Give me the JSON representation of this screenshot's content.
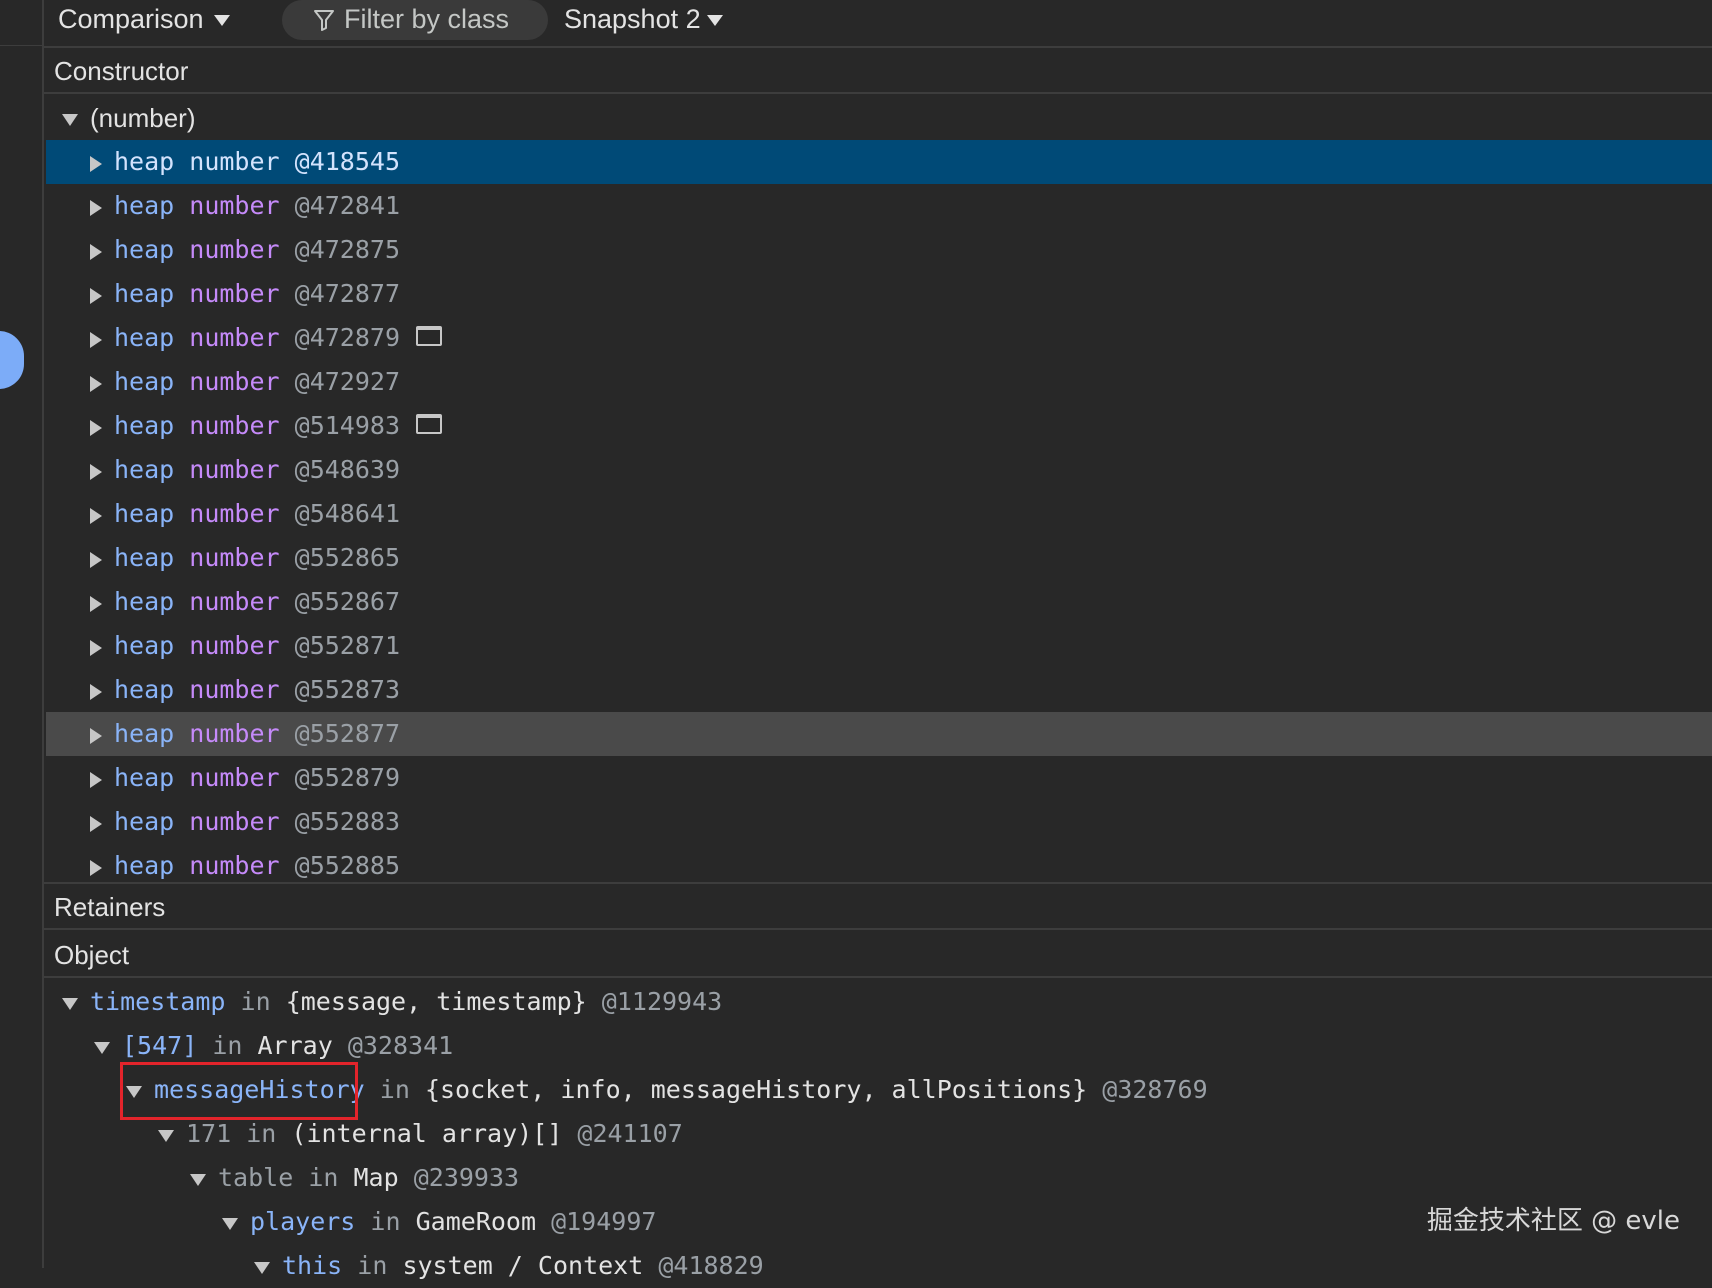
{
  "toolbar": {
    "view_mode": "Comparison",
    "filter_placeholder": "Filter by class",
    "snapshot_select": "Snapshot 2"
  },
  "constructor_panel": {
    "header": "Constructor",
    "group": {
      "label": "(number)"
    },
    "rows": [
      {
        "name": "heap number",
        "kw1": "heap",
        "kw2": "number",
        "id": "@418545",
        "selected": true,
        "store_icon": false
      },
      {
        "kw1": "heap",
        "kw2": "number",
        "id": "@472841",
        "store_icon": false
      },
      {
        "kw1": "heap",
        "kw2": "number",
        "id": "@472875",
        "store_icon": false
      },
      {
        "kw1": "heap",
        "kw2": "number",
        "id": "@472877",
        "store_icon": false
      },
      {
        "kw1": "heap",
        "kw2": "number",
        "id": "@472879",
        "store_icon": true
      },
      {
        "kw1": "heap",
        "kw2": "number",
        "id": "@472927",
        "store_icon": false
      },
      {
        "kw1": "heap",
        "kw2": "number",
        "id": "@514983",
        "store_icon": true
      },
      {
        "kw1": "heap",
        "kw2": "number",
        "id": "@548639",
        "store_icon": false
      },
      {
        "kw1": "heap",
        "kw2": "number",
        "id": "@548641",
        "store_icon": false
      },
      {
        "kw1": "heap",
        "kw2": "number",
        "id": "@552865",
        "store_icon": false
      },
      {
        "kw1": "heap",
        "kw2": "number",
        "id": "@552867",
        "store_icon": false
      },
      {
        "kw1": "heap",
        "kw2": "number",
        "id": "@552871",
        "store_icon": false
      },
      {
        "kw1": "heap",
        "kw2": "number",
        "id": "@552873",
        "store_icon": false
      },
      {
        "kw1": "heap",
        "kw2": "number",
        "id": "@552877",
        "hovered": true,
        "store_icon": false
      },
      {
        "kw1": "heap",
        "kw2": "number",
        "id": "@552879",
        "store_icon": false
      },
      {
        "kw1": "heap",
        "kw2": "number",
        "id": "@552883",
        "store_icon": false
      },
      {
        "kw1": "heap",
        "kw2": "number",
        "id": "@552885",
        "store_icon": false
      }
    ]
  },
  "retainers_panel": {
    "header": "Retainers",
    "column": "Object",
    "rows": [
      {
        "prop": "timestamp",
        "in": "in",
        "cls": "{message, timestamp}",
        "id": "@1129943"
      },
      {
        "prop": "[547]",
        "in": "in",
        "cls": "Array",
        "id": "@328341"
      },
      {
        "prop": "messageHistory",
        "in": "in",
        "cls": "{socket, info, messageHistory, allPositions}",
        "id": "@328769",
        "highlighted": true
      },
      {
        "prop": "171",
        "in": "in",
        "cls": "(internal array)[]",
        "id": "@241107"
      },
      {
        "prop": "table",
        "in": "in",
        "cls": "Map",
        "id": "@239933"
      },
      {
        "prop": "players",
        "in": "in",
        "cls": "GameRoom",
        "id": "@194997"
      },
      {
        "prop": "this",
        "in": "in",
        "cls": "system / Context",
        "id": "@418829"
      }
    ]
  },
  "watermark": "掘金技术社区 @ evle",
  "colors": {
    "background": "#282828",
    "selected_row": "#004a77",
    "hover_row": "#4a4a4a",
    "keyword_blue": "#8ab4f8",
    "keyword_purple": "#c58af9",
    "highlight_box": "#e3242b",
    "drawer_knob": "#7cacf8"
  }
}
